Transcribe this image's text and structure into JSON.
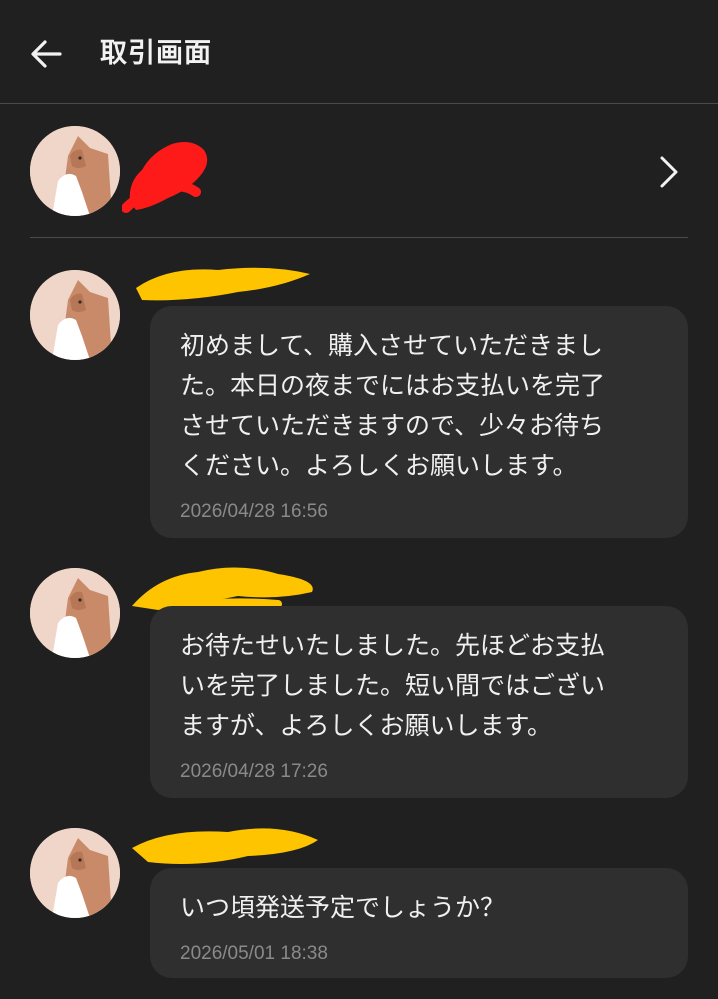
{
  "header": {
    "title": "取引画面",
    "back_icon": "arrow-left-icon"
  },
  "seller": {
    "avatar_icon": "cat-avatar-icon",
    "name_redacted": true,
    "redaction_color": "#ff1a1a",
    "chevron_icon": "chevron-right-icon"
  },
  "messages": [
    {
      "text": "初めまして、購入させていただきました。本日の夜までにはお支払いを完了させていただきますので、少々お待ちください。よろしくお願いします。",
      "lines": [
        "初めまして、購入させていただきまし",
        "た。本日の夜までにはお支払いを完了",
        "させていただきますので、少々お待ち",
        "ください。よろしくお願いします。"
      ],
      "time": "2026/04/28 16:56"
    },
    {
      "text": "お待たせいたしました。先ほどお支払いを完了しました。短い間ではございますが、よろしくお願いします。",
      "lines": [
        "お待たせいたしました。先ほどお支払",
        "いを完了しました。短い間ではござい",
        "ますが、よろしくお願いします。"
      ],
      "time": "2026/04/28 17:26"
    },
    {
      "text": "いつ頃発送予定でしょうか？",
      "lines": [
        "いつ頃発送予定でしょうか？"
      ],
      "time": "2026/05/01 18:38"
    }
  ],
  "colors": {
    "background": "#202020",
    "bubble": "#2f2f2f",
    "timestamp": "#8a8a8a",
    "divider": "#4a4a4a",
    "name_redaction_yellow": "#ffc400",
    "avatar_bg": "#f0d5c9"
  }
}
